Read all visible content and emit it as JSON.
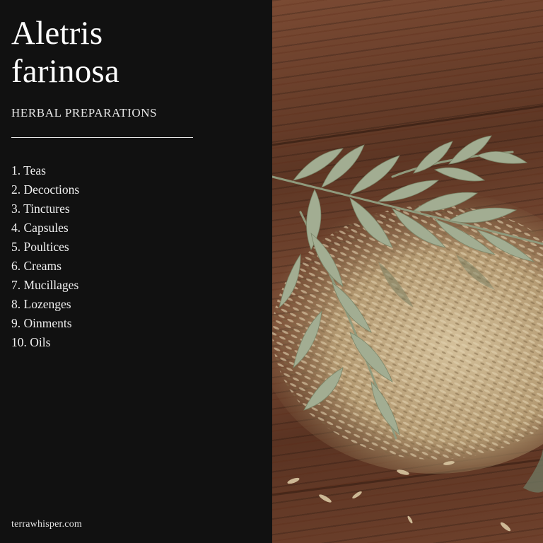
{
  "header": {
    "title_line1": "Aletris",
    "title_line2": "farinosa",
    "subtitle": "HERBAL PREPARATIONS"
  },
  "list": {
    "items": [
      "1. Teas",
      "2. Decoctions",
      "3. Tinctures",
      "4. Capsules",
      "5. Poultices",
      "6. Creams",
      "7. Mucillages",
      "8. Lozenges",
      "9. Oinments",
      "10. Oils"
    ]
  },
  "footer": {
    "site": "terrawhisper.com"
  },
  "photo": {
    "icon": "herb-sprig-on-seeds-photo"
  },
  "colors": {
    "panel_bg": "#111111",
    "text": "#ffffff",
    "wood": "#6b3f2a",
    "leaf": "#9aa58a",
    "seed": "#c9b48e"
  }
}
